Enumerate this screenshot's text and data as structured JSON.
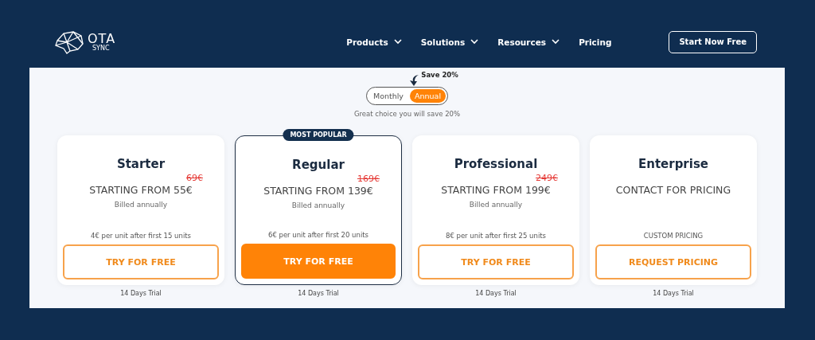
{
  "logo": {
    "title": "OTA",
    "subtitle": "SYNC"
  },
  "nav": [
    {
      "label": "Products",
      "dropdown": true
    },
    {
      "label": "Solutions",
      "dropdown": true
    },
    {
      "label": "Resources",
      "dropdown": true
    },
    {
      "label": "Pricing",
      "dropdown": false
    }
  ],
  "cta": "Start Now Free",
  "billing": {
    "save_note": "Save 20%",
    "options": [
      {
        "label": "Monthly",
        "selected": false
      },
      {
        "label": "Annual",
        "selected": true
      }
    ],
    "hint": "Great choice you will save 20%"
  },
  "plans": [
    {
      "name": "Starter",
      "featured": false,
      "old_price": "69€",
      "price": "STARTING FROM 55€",
      "billing": "Billed annually",
      "extra": "4€ per unit after first 15 units",
      "button": "TRY FOR FREE",
      "trial": "14 Days Trial"
    },
    {
      "name": "Regular",
      "featured": true,
      "badge": "MOST POPULAR",
      "old_price": "169€",
      "price": "STARTING FROM 139€",
      "billing": "Billed annually",
      "extra": "6€ per unit after first 20 units",
      "button": "TRY FOR FREE",
      "trial": "14 Days Trial"
    },
    {
      "name": "Professional",
      "featured": false,
      "old_price": "249€",
      "price": "STARTING FROM 199€",
      "billing": "Billed annually",
      "extra": "8€ per unit after first 25 units",
      "button": "TRY FOR FREE",
      "trial": "14 Days Trial"
    },
    {
      "name": "Enterprise",
      "featured": false,
      "price": "CONTACT FOR PRICING",
      "extra": "CUSTOM PRICING",
      "button": "REQUEST PRICING",
      "trial": "14 Days Trial"
    }
  ]
}
